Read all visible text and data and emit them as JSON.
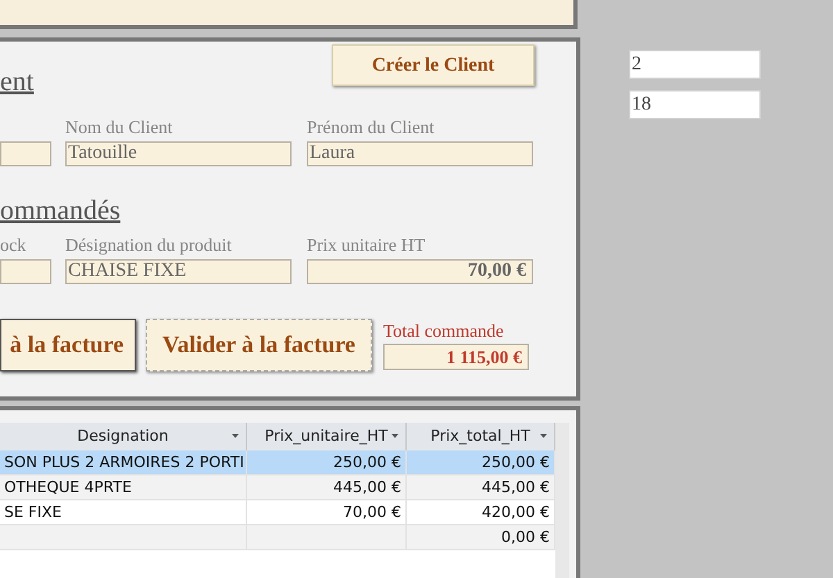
{
  "client_section": {
    "heading": "ent",
    "create_button": "Créer le Client",
    "fields": [
      {
        "kind": "text"
      },
      {
        "label": "Nom du Client",
        "value": "Tatouille",
        "kind": "text"
      },
      {
        "label": "Prénom du Client",
        "value": "Laura",
        "kind": "text"
      }
    ]
  },
  "products_section": {
    "heading": "ommandés",
    "fields": [
      {
        "label": "ock",
        "kind": "text"
      },
      {
        "label": "Désignation du produit",
        "value": "CHAISE FIXE",
        "kind": "text"
      },
      {
        "label": "Prix unitaire HT",
        "value": "70,00 €",
        "kind": "amount"
      }
    ]
  },
  "actions": {
    "add_button": "à la facture",
    "validate_button": "Valider à la facture",
    "total_label": "Total commande",
    "total_value": "1 115,00 €"
  },
  "table": {
    "columns": [
      "Designation",
      "Prix_unitaire_HT",
      "Prix_total_HT"
    ],
    "rows": [
      {
        "cells": [
          "SON PLUS 2 ARMOIRES 2 PORTI",
          "250,00 €",
          "250,00 €"
        ],
        "selected": true
      },
      {
        "cells": [
          "OTHEQUE 4PRTE",
          "445,00 €",
          "445,00 €"
        ],
        "selected": false
      },
      {
        "cells": [
          "SE FIXE",
          "70,00 €",
          "420,00 €"
        ],
        "selected": false
      },
      {
        "cells": [
          "",
          "",
          "0,00 €"
        ],
        "selected": false
      }
    ]
  },
  "side_fields": [
    "2",
    "18"
  ]
}
